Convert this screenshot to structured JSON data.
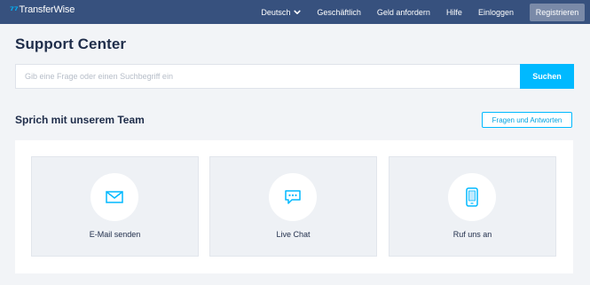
{
  "brand": {
    "name": "TransferWise",
    "mark": "⁷⁷",
    "accent": "#00b9ff",
    "nav_bg": "#37517e"
  },
  "nav": {
    "language": "Deutsch",
    "items": [
      "Geschäftlich",
      "Geld anfordern",
      "Hilfe",
      "Einloggen"
    ],
    "register": "Registrieren"
  },
  "page": {
    "title": "Support Center"
  },
  "search": {
    "placeholder": "Gib eine Frage oder einen Suchbegriff ein",
    "value": "",
    "button": "Suchen"
  },
  "team": {
    "title": "Sprich mit unserem Team",
    "faq_button": "Fragen und Antworten",
    "cards": [
      {
        "label": "E-Mail senden",
        "icon": "envelope-icon"
      },
      {
        "label": "Live Chat",
        "icon": "chat-bubble-icon"
      },
      {
        "label": "Ruf uns an",
        "icon": "phone-icon"
      }
    ]
  }
}
